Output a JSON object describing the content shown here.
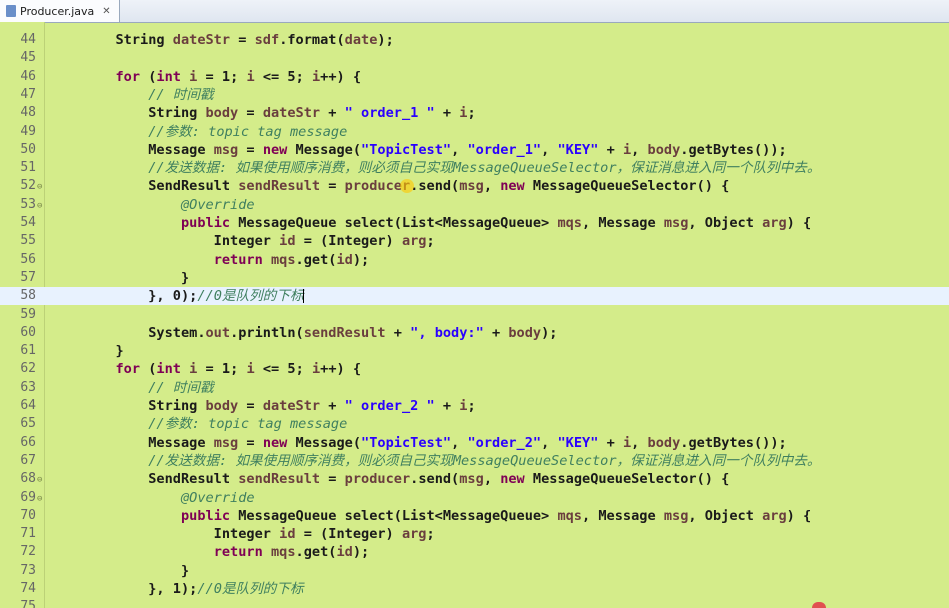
{
  "tab": {
    "title": "Producer.java",
    "close": "✕"
  },
  "lines": [
    {
      "n": "44",
      "segs": [
        [
          "t",
          "        String "
        ],
        [
          "v",
          "dateStr"
        ],
        [
          "t",
          " = "
        ],
        [
          "v",
          "sdf"
        ],
        [
          "t",
          ".format("
        ],
        [
          "v",
          "date"
        ],
        [
          "t",
          ");"
        ]
      ]
    },
    {
      "n": "45",
      "segs": []
    },
    {
      "n": "46",
      "segs": [
        [
          "t",
          "        "
        ],
        [
          "k",
          "for"
        ],
        [
          "t",
          " ("
        ],
        [
          "k",
          "int"
        ],
        [
          "t",
          " "
        ],
        [
          "v",
          "i"
        ],
        [
          "t",
          " = 1; "
        ],
        [
          "v",
          "i"
        ],
        [
          "t",
          " <= 5; "
        ],
        [
          "v",
          "i"
        ],
        [
          "t",
          "++) {"
        ]
      ]
    },
    {
      "n": "47",
      "segs": [
        [
          "c",
          "            // 时间戳"
        ]
      ]
    },
    {
      "n": "48",
      "segs": [
        [
          "t",
          "            String "
        ],
        [
          "v",
          "body"
        ],
        [
          "t",
          " = "
        ],
        [
          "v",
          "dateStr"
        ],
        [
          "t",
          " + "
        ],
        [
          "s",
          "\" order_1 \""
        ],
        [
          "t",
          " + "
        ],
        [
          "v",
          "i"
        ],
        [
          "t",
          ";"
        ]
      ]
    },
    {
      "n": "49",
      "segs": [
        [
          "c",
          "            //参数: topic tag message"
        ]
      ]
    },
    {
      "n": "50",
      "segs": [
        [
          "t",
          "            Message "
        ],
        [
          "v",
          "msg"
        ],
        [
          "t",
          " = "
        ],
        [
          "k",
          "new"
        ],
        [
          "t",
          " Message("
        ],
        [
          "s",
          "\"TopicTest\""
        ],
        [
          "t",
          ", "
        ],
        [
          "s",
          "\"order_1\""
        ],
        [
          "t",
          ", "
        ],
        [
          "s",
          "\"KEY\""
        ],
        [
          "t",
          " + "
        ],
        [
          "v",
          "i"
        ],
        [
          "t",
          ", "
        ],
        [
          "v",
          "body"
        ],
        [
          "t",
          ".getBytes());"
        ]
      ]
    },
    {
      "n": "51",
      "segs": [
        [
          "c",
          "            //发送数据: 如果使用顺序消费，则必须自己实现MessageQueueSelector，保证消息进入同一个队列中去。"
        ]
      ]
    },
    {
      "n": "52",
      "fold": true,
      "segs": [
        [
          "t",
          "            SendResult "
        ],
        [
          "v",
          "sendResult"
        ],
        [
          "t",
          " = "
        ],
        [
          "v",
          "producer"
        ],
        [
          "t",
          ".send("
        ],
        [
          "v",
          "msg"
        ],
        [
          "t",
          ", "
        ],
        [
          "k",
          "new"
        ],
        [
          "t",
          " MessageQueueSelector() {"
        ]
      ]
    },
    {
      "n": "53",
      "fold": true,
      "segs": [
        [
          "c",
          "                @Override"
        ]
      ]
    },
    {
      "n": "54",
      "segs": [
        [
          "t",
          "                "
        ],
        [
          "k",
          "public"
        ],
        [
          "t",
          " MessageQueue select(List<MessageQueue> "
        ],
        [
          "v",
          "mqs"
        ],
        [
          "t",
          ", Message "
        ],
        [
          "v",
          "msg"
        ],
        [
          "t",
          ", Object "
        ],
        [
          "v",
          "arg"
        ],
        [
          "t",
          ") {"
        ]
      ]
    },
    {
      "n": "55",
      "segs": [
        [
          "t",
          "                    Integer "
        ],
        [
          "v",
          "id"
        ],
        [
          "t",
          " = (Integer) "
        ],
        [
          "v",
          "arg"
        ],
        [
          "t",
          ";"
        ]
      ]
    },
    {
      "n": "56",
      "segs": [
        [
          "t",
          "                    "
        ],
        [
          "k",
          "return"
        ],
        [
          "t",
          " "
        ],
        [
          "v",
          "mqs"
        ],
        [
          "t",
          ".get("
        ],
        [
          "v",
          "id"
        ],
        [
          "t",
          ");"
        ]
      ]
    },
    {
      "n": "57",
      "segs": [
        [
          "t",
          "                }"
        ]
      ]
    },
    {
      "n": "58",
      "current": true,
      "segs": [
        [
          "t",
          "            }, 0);"
        ],
        [
          "c",
          "//0是队列的下标"
        ]
      ]
    },
    {
      "n": "59",
      "segs": []
    },
    {
      "n": "60",
      "segs": [
        [
          "t",
          "            System."
        ],
        [
          "v",
          "out"
        ],
        [
          "t",
          ".println("
        ],
        [
          "v",
          "sendResult"
        ],
        [
          "t",
          " + "
        ],
        [
          "s",
          "\", body:\""
        ],
        [
          "t",
          " + "
        ],
        [
          "v",
          "body"
        ],
        [
          "t",
          ");"
        ]
      ]
    },
    {
      "n": "61",
      "segs": [
        [
          "t",
          "        }"
        ]
      ]
    },
    {
      "n": "62",
      "segs": [
        [
          "t",
          "        "
        ],
        [
          "k",
          "for"
        ],
        [
          "t",
          " ("
        ],
        [
          "k",
          "int"
        ],
        [
          "t",
          " "
        ],
        [
          "v",
          "i"
        ],
        [
          "t",
          " = 1; "
        ],
        [
          "v",
          "i"
        ],
        [
          "t",
          " <= 5; "
        ],
        [
          "v",
          "i"
        ],
        [
          "t",
          "++) {"
        ]
      ]
    },
    {
      "n": "63",
      "segs": [
        [
          "c",
          "            // 时间戳"
        ]
      ]
    },
    {
      "n": "64",
      "segs": [
        [
          "t",
          "            String "
        ],
        [
          "v",
          "body"
        ],
        [
          "t",
          " = "
        ],
        [
          "v",
          "dateStr"
        ],
        [
          "t",
          " + "
        ],
        [
          "s",
          "\" order_2 \""
        ],
        [
          "t",
          " + "
        ],
        [
          "v",
          "i"
        ],
        [
          "t",
          ";"
        ]
      ]
    },
    {
      "n": "65",
      "segs": [
        [
          "c",
          "            //参数: topic tag message"
        ]
      ]
    },
    {
      "n": "66",
      "segs": [
        [
          "t",
          "            Message "
        ],
        [
          "v",
          "msg"
        ],
        [
          "t",
          " = "
        ],
        [
          "k",
          "new"
        ],
        [
          "t",
          " Message("
        ],
        [
          "s",
          "\"TopicTest\""
        ],
        [
          "t",
          ", "
        ],
        [
          "s",
          "\"order_2\""
        ],
        [
          "t",
          ", "
        ],
        [
          "s",
          "\"KEY\""
        ],
        [
          "t",
          " + "
        ],
        [
          "v",
          "i"
        ],
        [
          "t",
          ", "
        ],
        [
          "v",
          "body"
        ],
        [
          "t",
          ".getBytes());"
        ]
      ]
    },
    {
      "n": "67",
      "segs": [
        [
          "c",
          "            //发送数据: 如果使用顺序消费，则必须自己实现MessageQueueSelector，保证消息进入同一个队列中去。"
        ]
      ]
    },
    {
      "n": "68",
      "fold": true,
      "segs": [
        [
          "t",
          "            SendResult "
        ],
        [
          "v",
          "sendResult"
        ],
        [
          "t",
          " = "
        ],
        [
          "v",
          "producer"
        ],
        [
          "t",
          ".send("
        ],
        [
          "v",
          "msg"
        ],
        [
          "t",
          ", "
        ],
        [
          "k",
          "new"
        ],
        [
          "t",
          " MessageQueueSelector() {"
        ]
      ]
    },
    {
      "n": "69",
      "fold": true,
      "segs": [
        [
          "c",
          "                @Override"
        ]
      ]
    },
    {
      "n": "70",
      "segs": [
        [
          "t",
          "                "
        ],
        [
          "k",
          "public"
        ],
        [
          "t",
          " MessageQueue select(List<MessageQueue> "
        ],
        [
          "v",
          "mqs"
        ],
        [
          "t",
          ", Message "
        ],
        [
          "v",
          "msg"
        ],
        [
          "t",
          ", Object "
        ],
        [
          "v",
          "arg"
        ],
        [
          "t",
          ") {"
        ]
      ]
    },
    {
      "n": "71",
      "segs": [
        [
          "t",
          "                    Integer "
        ],
        [
          "v",
          "id"
        ],
        [
          "t",
          " = (Integer) "
        ],
        [
          "v",
          "arg"
        ],
        [
          "t",
          ";"
        ]
      ]
    },
    {
      "n": "72",
      "segs": [
        [
          "t",
          "                    "
        ],
        [
          "k",
          "return"
        ],
        [
          "t",
          " "
        ],
        [
          "v",
          "mqs"
        ],
        [
          "t",
          ".get("
        ],
        [
          "v",
          "id"
        ],
        [
          "t",
          ");"
        ]
      ]
    },
    {
      "n": "73",
      "segs": [
        [
          "t",
          "                }"
        ]
      ]
    },
    {
      "n": "74",
      "segs": [
        [
          "t",
          "            }, 1);"
        ],
        [
          "c",
          "//0是队列的下标"
        ]
      ]
    },
    {
      "n": "75",
      "segs": []
    }
  ]
}
